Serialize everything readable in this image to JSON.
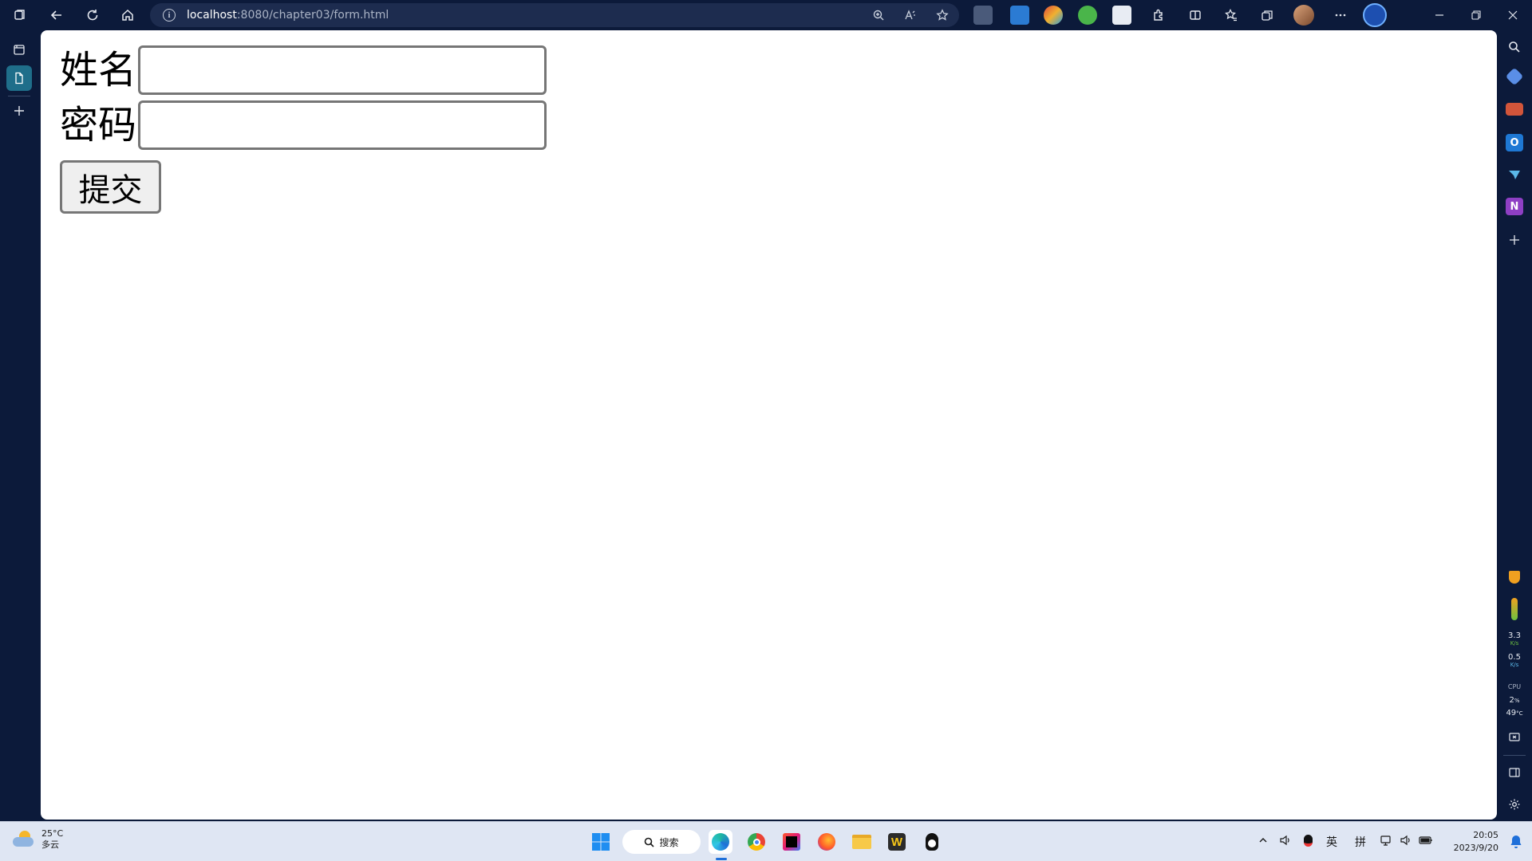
{
  "browser": {
    "url_host": "localhost",
    "url_path": ":8080/chapter03/form.html",
    "info_glyph": "i"
  },
  "form": {
    "name_label": "姓名",
    "name_value": "",
    "password_label": "密码",
    "password_value": "",
    "submit_label": "提交"
  },
  "sidebar_right": {
    "net_up": "3.3",
    "net_up_unit": "K/s",
    "net_down": "0.5",
    "net_down_unit": "K/s",
    "cpu_label": "CPU",
    "cpu_value": "2",
    "cpu_unit": "%",
    "temp_value": "49",
    "temp_unit": "°C"
  },
  "taskbar": {
    "weather_temp": "25°C",
    "weather_desc": "多云",
    "search_label": "搜索",
    "ime_lang": "英",
    "ime_mode": "拼",
    "time": "20:05",
    "date": "2023/9/20"
  },
  "colors": {
    "chrome_bg": "#0c1a3a",
    "address_bg": "#1d2c4f",
    "page_bg": "#ffffff",
    "taskbar_bg": "#dfe6f3",
    "active_tab": "#1f6e8a"
  }
}
